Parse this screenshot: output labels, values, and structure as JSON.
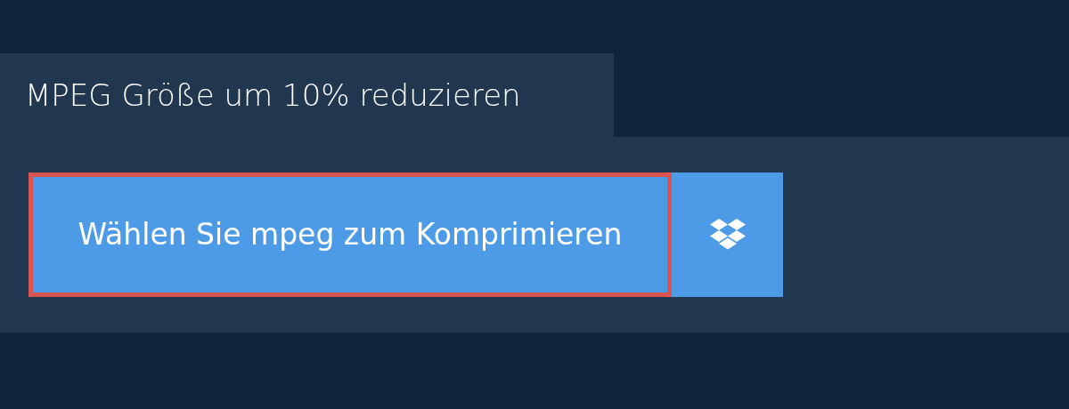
{
  "title": "MPEG Größe um 10% reduzieren",
  "upload_button": {
    "label": "Wählen Sie mpeg zum Komprimieren",
    "focused": true
  }
}
